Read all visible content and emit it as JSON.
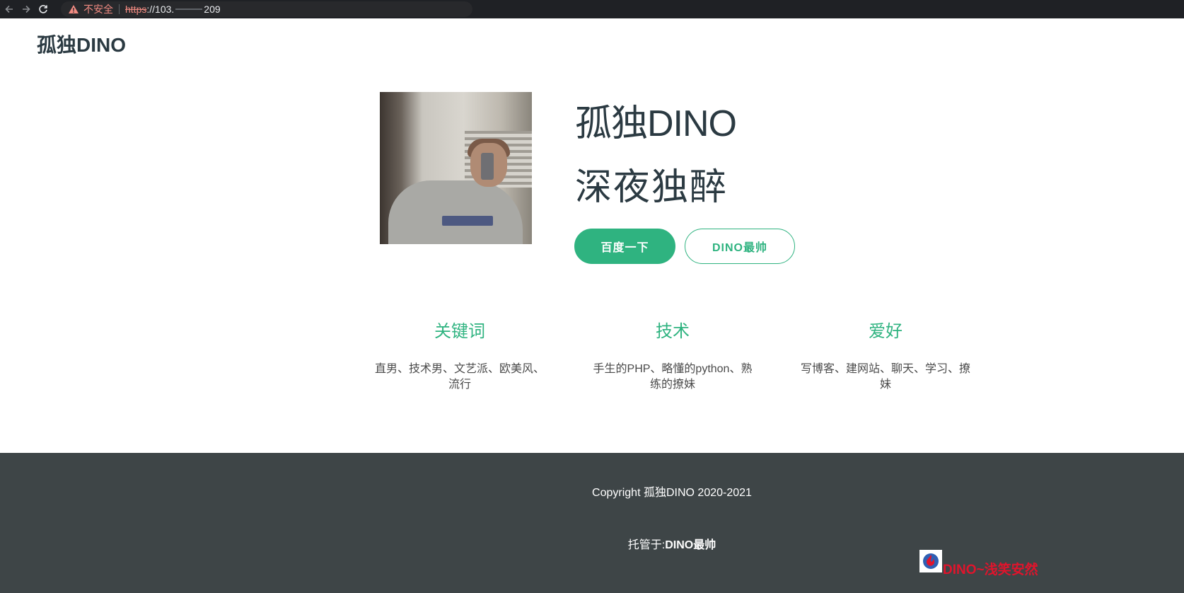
{
  "browser": {
    "security_label": "不安全",
    "url_scheme": "https",
    "url_prefix": "://103.",
    "url_suffix": "209"
  },
  "header": {
    "brand": "孤独DINO"
  },
  "hero": {
    "title": "孤独DINO",
    "subtitle": "深夜独醉",
    "primary_button": "百度一下",
    "secondary_button": "DINO最帅"
  },
  "features": [
    {
      "heading": "关键词",
      "text": "直男、技术男、文艺派、欧美风、流行"
    },
    {
      "heading": "技术",
      "text": "手生的PHP、略懂的python、熟练的撩妹"
    },
    {
      "heading": "爱好",
      "text": "写博客、建网站、聊天、学习、撩妹"
    }
  ],
  "footer": {
    "copyright": "Copyright 孤独DINO 2020-2021",
    "hosted_label": "托管于:",
    "hosted_value": "DINO最帅",
    "badge_text": "DINO~浅笑安然"
  },
  "colors": {
    "accent": "#2fb380",
    "footer_bg": "#3e4547",
    "heading": "#2b3a42",
    "badge_red": "#e0142c"
  }
}
